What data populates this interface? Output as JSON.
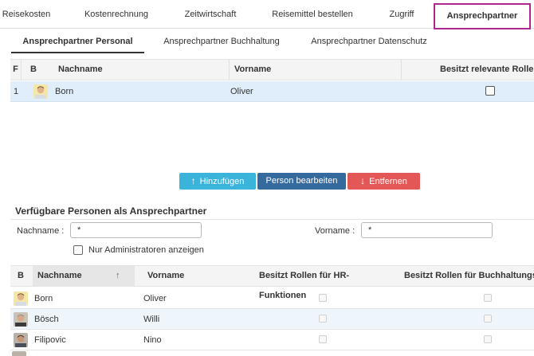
{
  "top_tabs": [
    "Reisekosten",
    "Kostenrechnung",
    "Zeitwirtschaft",
    "Reisemittel bestellen",
    "Zugriff",
    "Ansprechpartner"
  ],
  "sub_tabs": [
    "Ansprechpartner Personal",
    "Ansprechpartner Buchhaltung",
    "Ansprechpartner Datenschutz"
  ],
  "upper_grid": {
    "headers": [
      "F",
      "B",
      "Nachname",
      "Vorname",
      "Besitzt relevante Rollen"
    ],
    "rows": [
      {
        "num": "1",
        "nachname": "Born",
        "vorname": "Oliver",
        "relevant": false
      }
    ]
  },
  "buttons": {
    "add": "Hinzufügen",
    "edit": "Person bearbeiten",
    "remove": "Entfernen"
  },
  "section": {
    "title": "Verfügbare Personen als Ansprechpartner",
    "nachname_label": "Nachname :",
    "nachname_value": "*",
    "vorname_label": "Vorname :",
    "vorname_value": "*",
    "admin_only_label": "Nur Administratoren anzeigen"
  },
  "lower_grid": {
    "headers": [
      "B",
      "Nachname",
      "Vorname",
      "Besitzt Rollen für HR-Funktionen",
      "Besitzt Rollen für Buchhaltungsf"
    ],
    "rows": [
      {
        "nachname": "Born",
        "vorname": "Oliver"
      },
      {
        "nachname": "Bösch",
        "vorname": "Willi"
      },
      {
        "nachname": "Filipovic",
        "vorname": "Nino"
      }
    ]
  },
  "colors": {
    "active_tab_border": "#b0278f",
    "selected_row": "#dfeefa",
    "add": "#3bb4dc",
    "edit": "#356a9e",
    "remove": "#e45757"
  }
}
